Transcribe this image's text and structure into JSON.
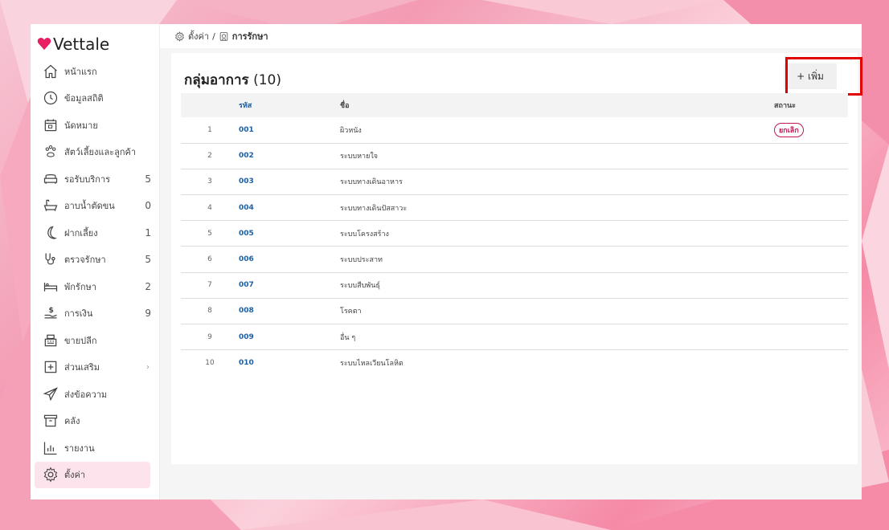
{
  "app": {
    "brand": "Vettale",
    "accent": "#e91e63"
  },
  "breadcrumb": {
    "root": "ตั้งค่า",
    "separator": "/",
    "current": "การรักษา"
  },
  "sidebar": {
    "items": [
      {
        "label": "หน้าแรก",
        "icon": "home-icon",
        "count": ""
      },
      {
        "label": "ข้อมูลสถิติ",
        "icon": "dashboard-gauge-icon",
        "count": ""
      },
      {
        "label": "นัดหมาย",
        "icon": "calendar-icon",
        "count": ""
      },
      {
        "label": "สัตว์เลี้ยงและลูกค้า",
        "icon": "paw-icon",
        "count": ""
      },
      {
        "label": "รอรับบริการ",
        "icon": "sofa-icon",
        "count": "5"
      },
      {
        "label": "อาบน้ำตัดขน",
        "icon": "bathtub-icon",
        "count": "0"
      },
      {
        "label": "ฝากเลี้ยง",
        "icon": "moon-icon",
        "count": "1"
      },
      {
        "label": "ตรวจรักษา",
        "icon": "stethoscope-icon",
        "count": "5"
      },
      {
        "label": "พักรักษา",
        "icon": "bed-icon",
        "count": "2"
      },
      {
        "label": "การเงิน",
        "icon": "money-hand-icon",
        "count": "9"
      },
      {
        "label": "ขายปลีก",
        "icon": "cash-register-icon",
        "count": ""
      },
      {
        "label": "ส่วนเสริม",
        "icon": "plus-box-icon",
        "count": "",
        "chevron": "›"
      },
      {
        "label": "ส่งข้อความ",
        "icon": "send-icon",
        "count": ""
      },
      {
        "label": "คลัง",
        "icon": "archive-icon",
        "count": ""
      },
      {
        "label": "รายงาน",
        "icon": "bar-chart-icon",
        "count": ""
      },
      {
        "label": "ตั้งค่า",
        "icon": "gear-icon",
        "count": "",
        "active": true
      }
    ]
  },
  "card": {
    "title": "กลุ่มอาการ",
    "count": "(10)",
    "add_label": "+ เพิ่ม"
  },
  "table": {
    "headers": {
      "no": "",
      "code": "รหัส",
      "name": "ชื่อ",
      "status": "สถานะ"
    },
    "rows": [
      {
        "no": "1",
        "code": "001",
        "name": "ผิวหนัง",
        "status": "ยกเลิก"
      },
      {
        "no": "2",
        "code": "002",
        "name": "ระบบหายใจ",
        "status": ""
      },
      {
        "no": "3",
        "code": "003",
        "name": "ระบบทางเดินอาหาร",
        "status": ""
      },
      {
        "no": "4",
        "code": "004",
        "name": "ระบบทางเดินปัสสาวะ",
        "status": ""
      },
      {
        "no": "5",
        "code": "005",
        "name": "ระบบโครงสร้าง",
        "status": ""
      },
      {
        "no": "6",
        "code": "006",
        "name": "ระบบประสาท",
        "status": ""
      },
      {
        "no": "7",
        "code": "007",
        "name": "ระบบสืบพันธุ์",
        "status": ""
      },
      {
        "no": "8",
        "code": "008",
        "name": "โรคตา",
        "status": ""
      },
      {
        "no": "9",
        "code": "009",
        "name": "อื่น ๆ",
        "status": ""
      },
      {
        "no": "10",
        "code": "010",
        "name": "ระบบไหลเวียนโลหิต",
        "status": ""
      }
    ]
  }
}
